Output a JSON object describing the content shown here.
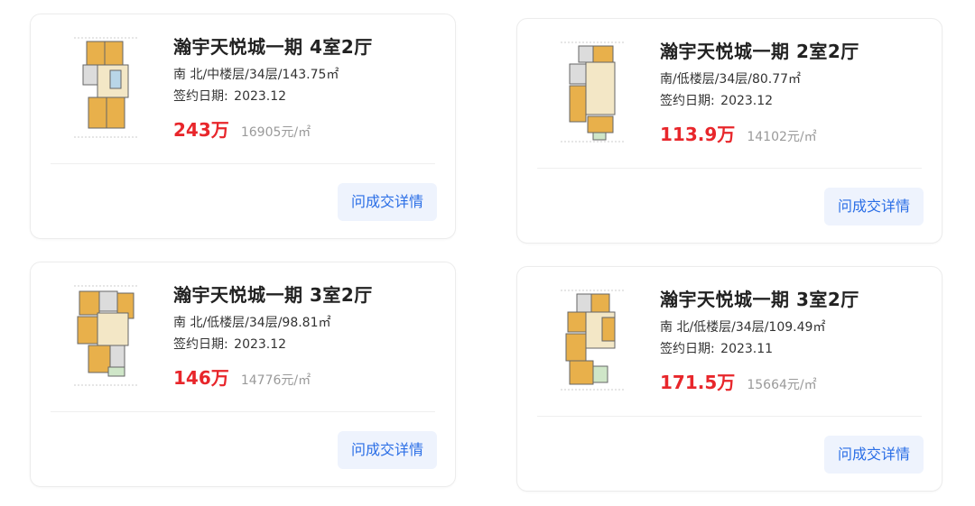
{
  "listings": [
    {
      "title": "瀚宇天悦城一期 4室2厅",
      "info": "南 北/中楼层/34层/143.75㎡",
      "date_label": "签约日期:",
      "date_value": "2023.12",
      "price": "243万",
      "unit_price": "16905元/㎡",
      "button_label": "问成交详情"
    },
    {
      "title": "瀚宇天悦城一期 2室2厅",
      "info": "南/低楼层/34层/80.77㎡",
      "date_label": "签约日期:",
      "date_value": "2023.12",
      "price": "113.9万",
      "unit_price": "14102元/㎡",
      "button_label": "问成交详情"
    },
    {
      "title": "瀚宇天悦城一期 3室2厅",
      "info": "南 北/低楼层/34层/98.81㎡",
      "date_label": "签约日期:",
      "date_value": "2023.12",
      "price": "146万",
      "unit_price": "14776元/㎡",
      "button_label": "问成交详情"
    },
    {
      "title": "瀚宇天悦城一期 3室2厅",
      "info": "南 北/低楼层/34层/109.49㎡",
      "date_label": "签约日期:",
      "date_value": "2023.11",
      "price": "171.5万",
      "unit_price": "15664元/㎡",
      "button_label": "问成交详情"
    }
  ],
  "colors": {
    "price": "#e8262b",
    "button_text": "#2a6ee6",
    "button_bg": "#eef3fd",
    "title": "#222222",
    "muted": "#9a9a9a"
  },
  "icons": {
    "floorplan": "floorplan-thumbnail"
  }
}
